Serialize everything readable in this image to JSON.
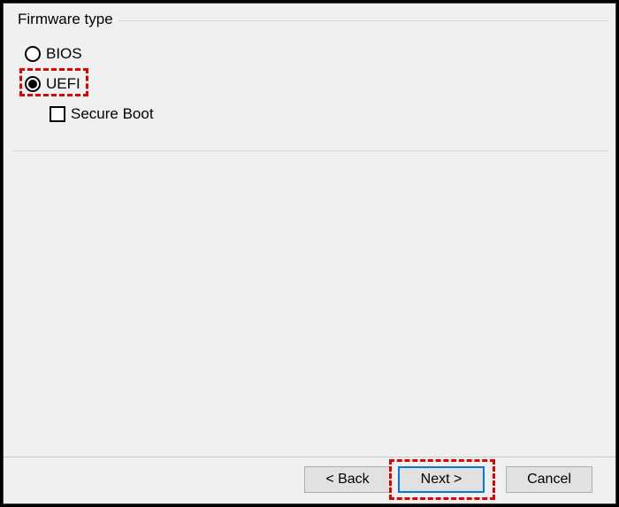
{
  "group": {
    "title": "Firmware type"
  },
  "options": {
    "bios": {
      "label": "BIOS",
      "selected": false
    },
    "uefi": {
      "label": "UEFI",
      "selected": true
    },
    "secure_boot": {
      "label": "Secure Boot",
      "checked": false
    }
  },
  "buttons": {
    "back": "< Back",
    "next": "Next >",
    "cancel": "Cancel"
  },
  "highlight_color": "#e00000",
  "accent_color": "#0078d7"
}
